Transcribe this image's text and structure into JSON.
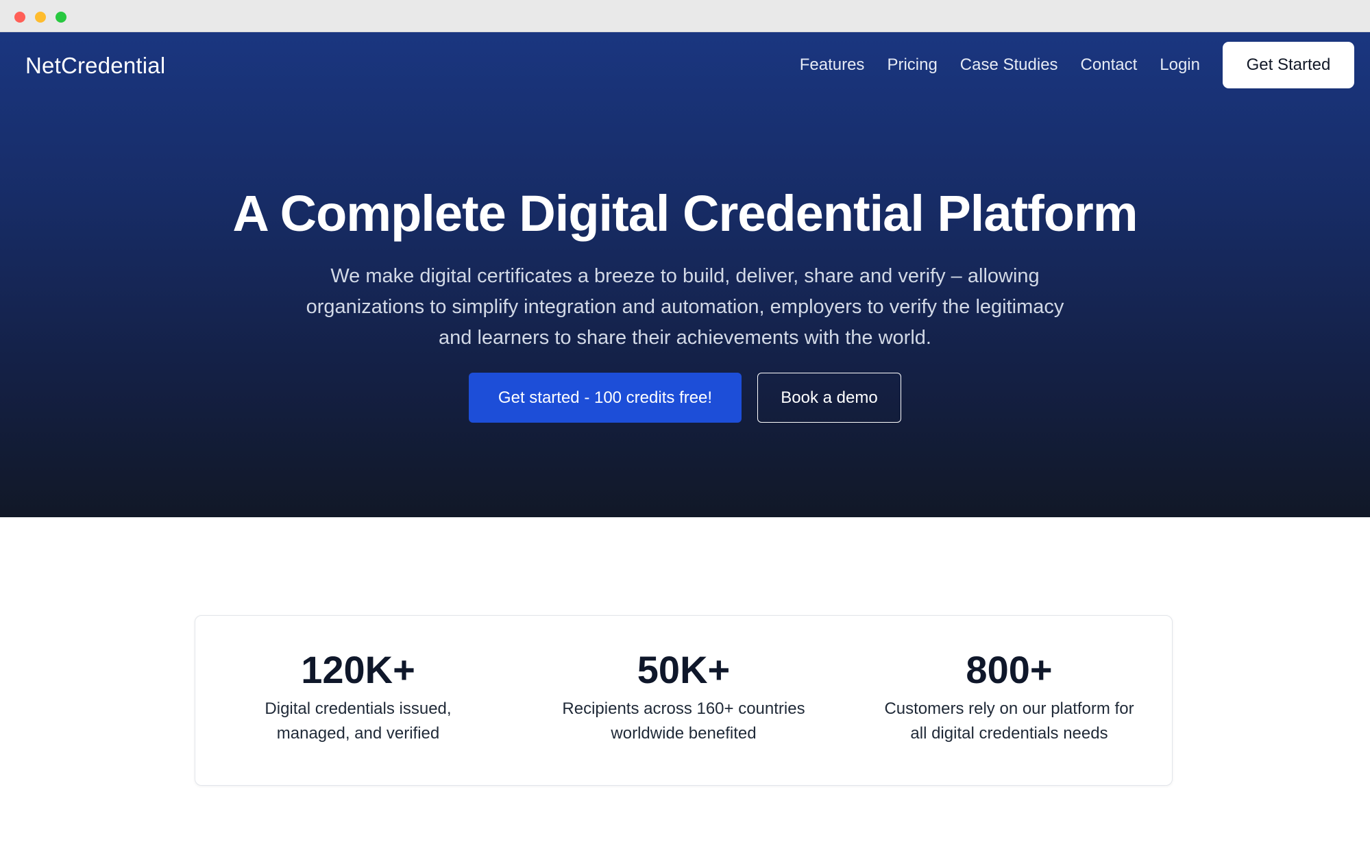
{
  "nav": {
    "brand": "NetCredential",
    "links": [
      "Features",
      "Pricing",
      "Case Studies",
      "Contact",
      "Login"
    ],
    "cta": "Get Started"
  },
  "hero": {
    "title": "A Complete Digital Credential Platform",
    "subtitle": "We make digital certificates a breeze to build, deliver, share and verify – allowing organizations to simplify integration and automation, employers to verify the legitimacy and learners to share their achievements with the world.",
    "primary_cta": "Get started - 100 credits free!",
    "secondary_cta": "Book a demo"
  },
  "stats": [
    {
      "value": "120K+",
      "desc": "Digital credentials issued, managed, and verified"
    },
    {
      "value": "50K+",
      "desc": "Recipients across 160+ countries worldwide benefited"
    },
    {
      "value": "800+",
      "desc": "Customers rely on our platform for all digital credentials needs"
    }
  ],
  "colors": {
    "hero_top": "#1a3680",
    "hero_bottom": "#111827",
    "primary_button": "#1d4ed8"
  }
}
